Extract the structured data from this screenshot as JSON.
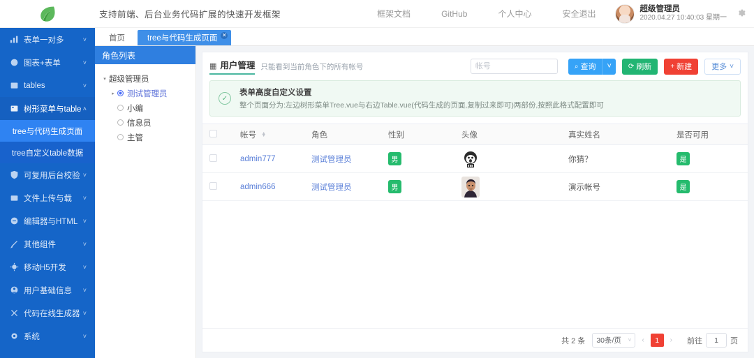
{
  "header": {
    "logo_icon": "leaf-icon",
    "slogan": "支持前端、后台业务代码扩展的快速开发框架",
    "nav": [
      {
        "label": "框架文档"
      },
      {
        "label": "GitHub"
      },
      {
        "label": "个人中心"
      },
      {
        "label": "安全退出"
      }
    ],
    "user": {
      "name": "超级管理员",
      "datetime": "2020.04.27 10:40:03 星期一",
      "avatar_icon": "user-avatar"
    },
    "settings_icon": "gear-icon"
  },
  "sidebar": {
    "items": [
      {
        "label": "表单一对多",
        "icon": "chart-bar-icon",
        "chevron": "˅",
        "open": false
      },
      {
        "label": "图表+表单",
        "icon": "pie-chart-icon",
        "chevron": "˅",
        "open": false
      },
      {
        "label": "tables",
        "icon": "table-icon",
        "chevron": "˅",
        "open": false
      },
      {
        "label": "树形菜单与table",
        "icon": "tree-menu-icon",
        "chevron": "˄",
        "open": true
      },
      {
        "label": "可复用后台校验",
        "icon": "shield-check-icon",
        "chevron": "˅",
        "open": false
      },
      {
        "label": "文件上传与载",
        "icon": "upload-icon",
        "chevron": "˅",
        "open": false
      },
      {
        "label": "编辑器与HTML",
        "icon": "editor-icon",
        "chevron": "˅",
        "open": false
      },
      {
        "label": "其他组件",
        "icon": "wrench-icon",
        "chevron": "˅",
        "open": false
      },
      {
        "label": "移动H5开发",
        "icon": "mobile-icon",
        "chevron": "˅",
        "open": false
      },
      {
        "label": "用户基础信息",
        "icon": "user-info-icon",
        "chevron": "˅",
        "open": false
      },
      {
        "label": "代码在线生成器",
        "icon": "code-gen-icon",
        "chevron": "˅",
        "open": false
      },
      {
        "label": "系统",
        "icon": "cog-icon",
        "chevron": "˅",
        "open": false
      }
    ],
    "submenu": [
      {
        "label": "tree与代码生成页面",
        "active": true
      },
      {
        "label": "tree自定义table数据",
        "active": false
      }
    ]
  },
  "tabs": [
    {
      "label": "首页",
      "active": false,
      "closable": false
    },
    {
      "label": "tree与代码生成页面",
      "active": true,
      "closable": true,
      "close_icon": "close-icon"
    }
  ],
  "tree_panel": {
    "title": "角色列表",
    "root": {
      "label": "超级管理员",
      "arrow": "▾"
    },
    "children": [
      {
        "label": "测试管理员",
        "selected": true,
        "arrow": "▸"
      },
      {
        "label": "小编",
        "selected": false,
        "arrow": ""
      },
      {
        "label": "信息员",
        "selected": false,
        "arrow": ""
      },
      {
        "label": "主管",
        "selected": false,
        "arrow": ""
      }
    ]
  },
  "content": {
    "title": "用户管理",
    "title_icon": "grid-icon",
    "subtitle": "只能看到当前角色下的所有帐号",
    "search": {
      "placeholder": "帐号",
      "value": ""
    },
    "buttons": {
      "query": {
        "label": "查询",
        "icon": "search-icon",
        "color": "#36a3f7"
      },
      "query_caret": {
        "icon": "chevron-down-icon"
      },
      "refresh": {
        "label": "刷新",
        "icon": "refresh-icon",
        "color": "#22b573"
      },
      "new": {
        "label": "新建",
        "icon": "plus-icon",
        "color": "#f04134"
      },
      "more": {
        "label": "更多",
        "icon": "chevron-down-icon",
        "color": "#5a8fd8"
      }
    },
    "alert": {
      "icon": "check-circle-icon",
      "title": "表单高度自定义设置",
      "desc": "整个页面分为:左边树形菜单Tree.vue与右边Table.vue(代码生成的页面,复制过来即可)两部份,按照此格式配置即可"
    },
    "table": {
      "columns": [
        "帐号",
        "角色",
        "性别",
        "头像",
        "真实姓名",
        "是否可用"
      ],
      "sortable_column": "帐号",
      "rows": [
        {
          "account": "admin777",
          "role": "测试管理员",
          "gender": "男",
          "avatar_icon": "avatar-cartoon",
          "real_name": "你猜？",
          "enabled": "是"
        },
        {
          "account": "admin666",
          "role": "测试管理员",
          "gender": "男",
          "avatar_icon": "avatar-photo",
          "real_name": "演示帐号",
          "enabled": "是"
        }
      ]
    },
    "pagination": {
      "total_text": "共 2 条",
      "page_size": "30条/页",
      "prev_icon": "chevron-left-icon",
      "next_icon": "chevron-right-icon",
      "current_page": "1",
      "goto_label": "前往",
      "goto_value": "1",
      "page_unit": "页"
    }
  },
  "theme": {
    "sidebar_bg": "#1565c8",
    "accent_blue": "#36a3f7",
    "green": "#22b573",
    "red": "#f04134",
    "tag_green": "#25bb6d"
  }
}
